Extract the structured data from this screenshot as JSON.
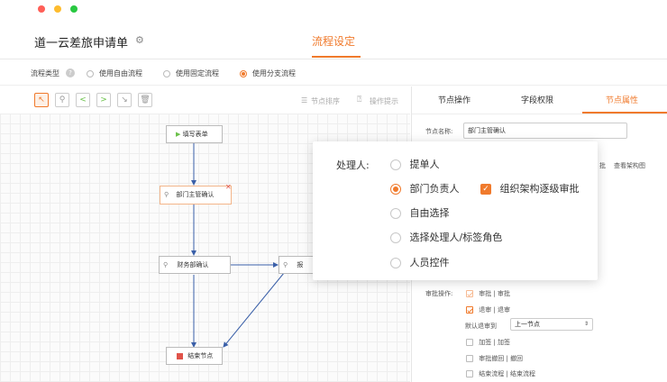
{
  "header": {
    "app_title": "道一云差旅申请单",
    "tab_flow": "流程设定"
  },
  "flow_type": {
    "label": "流程类型",
    "options": [
      "使用自由流程",
      "使用固定流程",
      "使用分支流程"
    ],
    "selected": "使用分支流程"
  },
  "toolbar": {
    "sort": "节点排序",
    "tips": "操作提示"
  },
  "nodes": {
    "start": "填写表单",
    "dept_head": "部门主管确认",
    "finance": "财务部确认",
    "hidden": "报",
    "end": "结束节点"
  },
  "panel": {
    "tabs": [
      "节点操作",
      "字段权限",
      "节点属性"
    ],
    "active_tab": "节点属性",
    "node_name_label": "节点名称:",
    "node_name_value": "部门主管确认",
    "side_link_1": "批",
    "side_link_2": "查看架构图",
    "approve_ops_label": "审批操作:",
    "ops": [
      {
        "label": "审批 | 审批",
        "checked": true,
        "disabled": true
      },
      {
        "label": "退审 | 退审",
        "checked": true,
        "disabled": false
      }
    ],
    "default_return_label": "默认退审到",
    "default_return_value": "上一节点",
    "more_ops": [
      {
        "label": "加签 | 加签",
        "checked": false
      },
      {
        "label": "审批撤回 | 撤回",
        "checked": false
      },
      {
        "label": "结束流程 | 结束流程",
        "checked": false
      }
    ]
  },
  "popup": {
    "label": "处理人:",
    "options": [
      "提单人",
      "部门负责人",
      "自由选择",
      "选择处理人/标签角色",
      "人员控件"
    ],
    "selected": "部门负责人",
    "checkbox_label": "组织架构逐级审批",
    "checkbox_checked": true
  },
  "colors": {
    "accent": "#f07a2c",
    "flow_line": "#3a5fa8",
    "start_green": "#6bc14a",
    "end_red": "#e0534a"
  }
}
